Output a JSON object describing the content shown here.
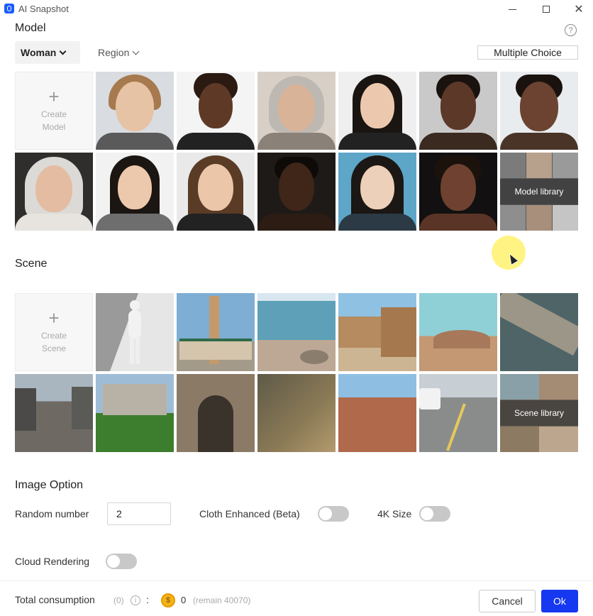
{
  "window": {
    "title": "AI Snapshot",
    "minimize_icon": "minimize-icon",
    "maximize_icon": "maximize-icon",
    "close_symbol": "✕"
  },
  "model": {
    "heading": "Model",
    "help_symbol": "?",
    "filter_gender": "Woman",
    "filter_region": "Region",
    "multiple_choice": "Multiple Choice",
    "create_line1": "Create",
    "create_line2": "Model",
    "library_label": "Model library",
    "thumbnails": [
      "woman-portrait-1",
      "woman-portrait-2",
      "woman-portrait-3",
      "woman-portrait-4",
      "woman-portrait-5",
      "woman-portrait-6",
      "woman-portrait-7",
      "woman-portrait-8",
      "woman-portrait-9",
      "woman-portrait-10",
      "woman-portrait-11",
      "woman-portrait-12"
    ]
  },
  "scene": {
    "heading": "Scene",
    "create_line1": "Create",
    "create_line2": "Scene",
    "library_label": "Scene library",
    "thumbnails": [
      "mannequin-studio",
      "mosque-tower",
      "rocky-beach",
      "stone-alley",
      "desert-mountains",
      "wooden-dock",
      "city-street",
      "chateau-lawn",
      "stone-archway",
      "autumn-forest",
      "red-canyon",
      "street-cars"
    ]
  },
  "image_option": {
    "heading": "Image Option",
    "random_number_label": "Random number",
    "random_number_value": "2",
    "cloth_enhanced_label": "Cloth Enhanced (Beta)",
    "cloth_enhanced_on": false,
    "size_4k_label": "4K Size",
    "size_4k_on": false,
    "cloud_rendering_label": "Cloud Rendering",
    "cloud_rendering_on": false
  },
  "footer": {
    "total_label": "Total consumption",
    "total_count": "(0)",
    "info_symbol": "i",
    "colon": ":",
    "coin_symbol": "$",
    "coin_value": "0",
    "remain": "(remain 40070)",
    "cancel_label": "Cancel",
    "ok_label": "Ok"
  },
  "colors": {
    "accent": "#1538f0",
    "toggle_off": "#c8c8c8",
    "coin": "#f2b51a"
  }
}
